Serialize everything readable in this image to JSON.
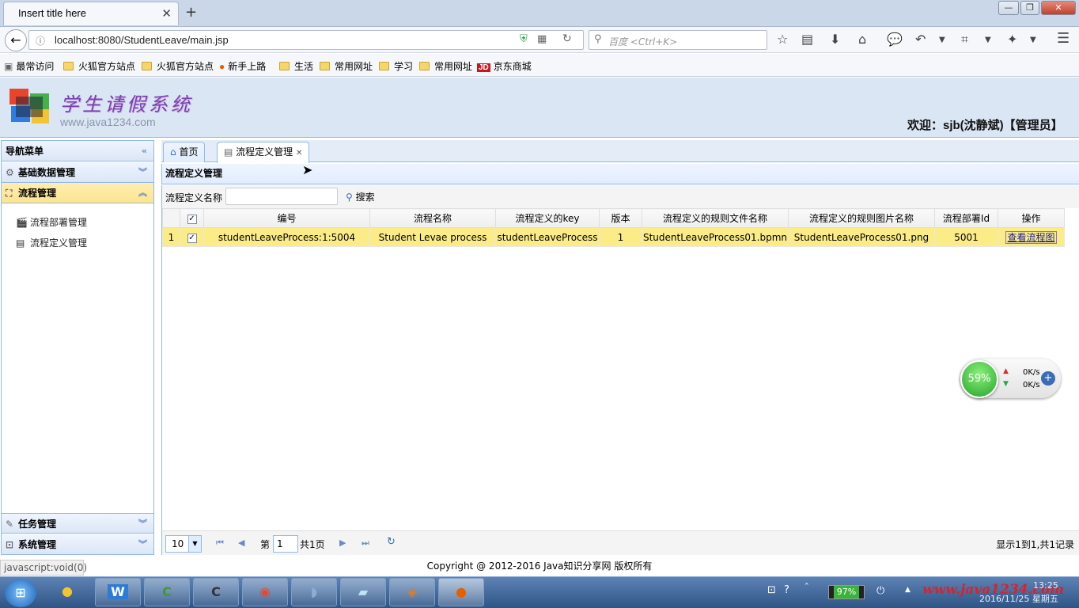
{
  "browser": {
    "tab_title": "Insert title here",
    "new_tab": "+",
    "url": "localhost:8080/StudentLeave/main.jsp",
    "search_placeholder": "百度 <Ctrl+K>",
    "bookmarks": [
      "最常访问",
      "火狐官方站点",
      "火狐官方站点",
      "新手上路",
      "生活",
      "常用网址",
      "学习",
      "常用网址",
      "京东商城"
    ],
    "jd_badge": "JD",
    "window_buttons": {
      "minimize": "—",
      "restore": "❐",
      "close": "✕"
    }
  },
  "app": {
    "title": "学生请假系统",
    "site": "www.java1234.com",
    "welcome": "欢迎：sjb(沈静斌)【管理员】"
  },
  "leftnav": {
    "header": "导航菜单",
    "sections": [
      {
        "label": "基础数据管理",
        "icon": "gear-icon",
        "expanded": false
      },
      {
        "label": "流程管理",
        "icon": "flowchart-icon",
        "expanded": true
      },
      {
        "label": "任务管理",
        "icon": "edit-icon",
        "expanded": false
      },
      {
        "label": "系统管理",
        "icon": "system-icon",
        "expanded": false
      }
    ],
    "flow_items": [
      "流程部署管理",
      "流程定义管理"
    ]
  },
  "main": {
    "tabs": [
      {
        "label": "首页",
        "icon": "home-icon"
      },
      {
        "label": "流程定义管理",
        "icon": "doc-icon",
        "closable": true
      }
    ],
    "panel_title": "流程定义管理",
    "search_label": "流程定义名称",
    "search_value": "",
    "search_button": "搜索",
    "columns": [
      "编号",
      "流程名称",
      "流程定义的key",
      "版本",
      "流程定义的规则文件名称",
      "流程定义的规则图片名称",
      "流程部署Id",
      "操作"
    ],
    "rows": [
      {
        "row_num": "1",
        "checked": true,
        "id": "studentLeaveProcess:1:5004",
        "name": "Student Levae process",
        "key": "studentLeaveProcess",
        "version": "1",
        "bpmn": "StudentLeaveProcess01.bpmn",
        "png": "StudentLeaveProcess01.png",
        "deploy_id": "5001",
        "action": "查看流程图"
      }
    ],
    "pager": {
      "page_size": "10",
      "page_prefix": "第",
      "page_value": "1",
      "page_total": "共1页",
      "info": "显示1到1,共1记录"
    }
  },
  "footer": {
    "copyright": "Copyright @ 2012-2016 Java知识分享网 版权所有",
    "status": "javascript:void(0)"
  },
  "widget": {
    "percent": "59%",
    "up": "0K/s",
    "down": "0K/s"
  },
  "taskbar": {
    "battery": "97%",
    "watermark": "www.java1234.com",
    "date": "2016/11/25 星期五",
    "time": "13:25"
  },
  "colors": {
    "accent_border": "#95b8e7",
    "selected_row": "#fbec88",
    "nav_selected": "#fce490",
    "title_purple": "#7a3fb0"
  }
}
